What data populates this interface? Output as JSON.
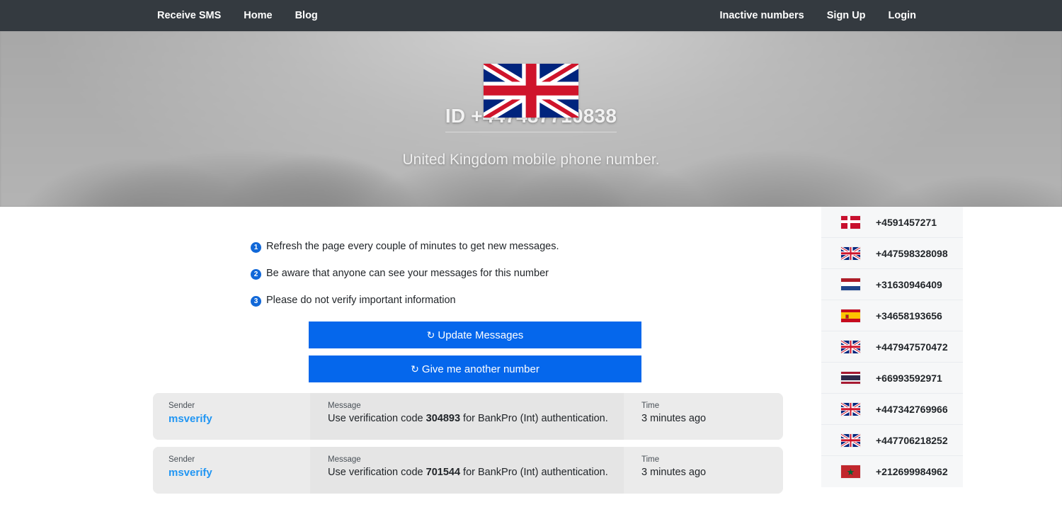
{
  "navbar": {
    "left_links": [
      {
        "label": "Receive SMS",
        "name": "nav-receive-sms"
      },
      {
        "label": "Home",
        "name": "nav-home"
      },
      {
        "label": "Blog",
        "name": "nav-blog"
      }
    ],
    "right_links": [
      {
        "label": "Inactive numbers",
        "name": "nav-inactive-numbers"
      },
      {
        "label": "Sign Up",
        "name": "nav-sign-up"
      },
      {
        "label": "Login",
        "name": "nav-login"
      }
    ],
    "background_color": "#343a40"
  },
  "hero": {
    "flag": "united-kingdom-flag",
    "id_text": "ID +447487710838",
    "subtitle": "United Kingdom mobile phone number."
  },
  "notices": [
    {
      "num": "1",
      "text": "Refresh the page every couple of minutes to get new messages."
    },
    {
      "num": "2",
      "text": "Be aware that anyone can see your messages for this number"
    },
    {
      "num": "3",
      "text": "Please do not verify important information"
    }
  ],
  "buttons": {
    "refresh_icon": "↻",
    "update": "Update Messages",
    "another": "Give me another number",
    "color": "#0567ec"
  },
  "table": {
    "headers": {
      "sender": "Sender",
      "message": "Message",
      "time": "Time"
    },
    "rows": [
      {
        "sender": "msverify",
        "message_prefix": "Use verification code ",
        "code": "304893",
        "message_suffix": " for BankPro (Int) authentication.",
        "time": "3 minutes ago"
      },
      {
        "sender": "msverify",
        "message_prefix": "Use verification code ",
        "code": "701544",
        "message_suffix": " for BankPro (Int) authentication.",
        "time": "3 minutes ago"
      }
    ]
  },
  "sidebar": {
    "items": [
      {
        "flag": "denmark-flag",
        "flag_class": "dk",
        "number": "+4591457271"
      },
      {
        "flag": "united-kingdom-flag",
        "flag_class": "uk",
        "number": "+447598328098"
      },
      {
        "flag": "netherlands-flag",
        "flag_class": "nl",
        "number": "+31630946409"
      },
      {
        "flag": "spain-flag",
        "flag_class": "es",
        "number": "+34658193656"
      },
      {
        "flag": "united-kingdom-flag",
        "flag_class": "uk",
        "number": "+447947570472"
      },
      {
        "flag": "thailand-flag",
        "flag_class": "th",
        "number": "+66993592971"
      },
      {
        "flag": "united-kingdom-flag",
        "flag_class": "uk",
        "number": "+447342769966"
      },
      {
        "flag": "united-kingdom-flag",
        "flag_class": "uk",
        "number": "+447706218252"
      },
      {
        "flag": "morocco-flag",
        "flag_class": "ma",
        "number": "+212699984962"
      }
    ]
  }
}
